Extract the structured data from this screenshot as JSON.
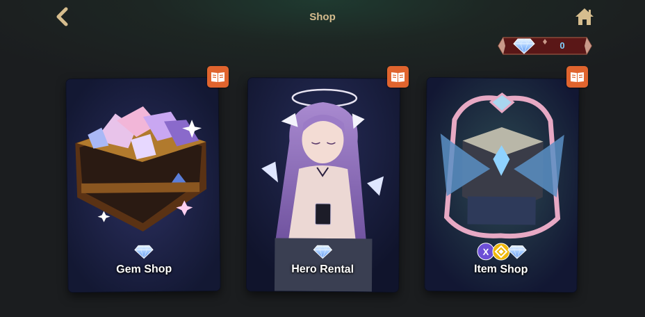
{
  "header": {
    "title": "Shop",
    "back_icon": "chevron-left-icon",
    "home_icon": "home-icon"
  },
  "currency": {
    "gem_count": "0",
    "icon": "diamond-icon"
  },
  "cards": [
    {
      "label": "Gem Shop",
      "art": "treasure-chest-with-crystals",
      "badge_icon": "book-icon"
    },
    {
      "label": "Hero Rental",
      "art": "angel-girl-portrait",
      "badge_icon": "book-icon"
    },
    {
      "label": "Item Shop",
      "art": "winged-treasure-chest",
      "badge_icon": "book-icon"
    }
  ],
  "colors": {
    "title": "#d6bd8e",
    "badge": "#e0642e",
    "counter_frame": "#5a1717",
    "gem_count": "#7fd2ff",
    "card_bg": "#141a33"
  }
}
